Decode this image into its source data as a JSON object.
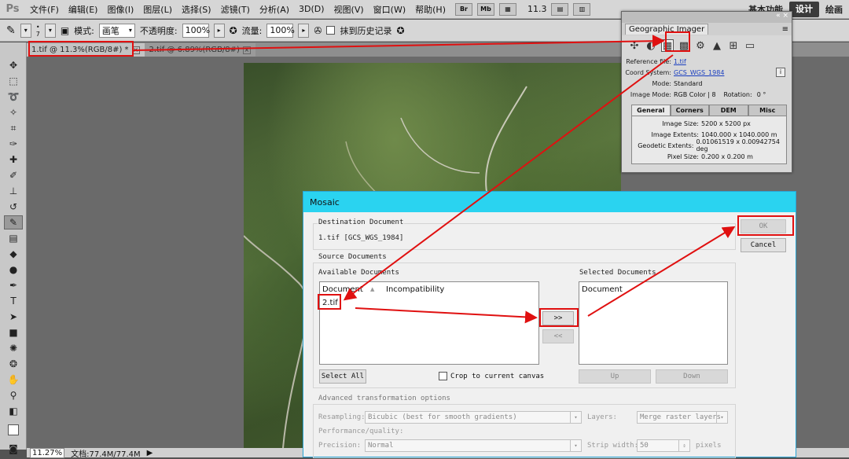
{
  "menubar": {
    "logo": "Ps",
    "items": [
      "文件(F)",
      "编辑(E)",
      "图像(I)",
      "图层(L)",
      "选择(S)",
      "滤镜(T)",
      "分析(A)",
      "3D(D)",
      "视图(V)",
      "窗口(W)",
      "帮助(H)"
    ],
    "mini_buttons": [
      "Br",
      "Mb"
    ],
    "zoom": "11.3",
    "workspaces": [
      "基本功能",
      "设计",
      "绘画"
    ]
  },
  "options": {
    "brush_size": "7",
    "mode_label": "模式:",
    "mode_value": "画笔",
    "opacity_label": "不透明度:",
    "opacity_value": "100%",
    "flow_label": "流量:",
    "flow_value": "100%",
    "erase_history_label": "抹到历史记录"
  },
  "tabs": [
    {
      "label": "1.tif @ 11.3%(RGB/8#) *",
      "active": true
    },
    {
      "label": "2.tif @ 6.89%(RGB/8#)",
      "active": false
    }
  ],
  "statusbar": {
    "zoom": "11.27%",
    "doc_info": "文档:77.4M/77.4M"
  },
  "geo_panel": {
    "tab": "Geographic Imager",
    "reference_file_label": "Reference file:",
    "reference_file": "1.tif",
    "coord_label": "Coord System:",
    "coord_value": "GCS_WGS_1984",
    "mode_label": "Mode:",
    "mode_value": "Standard",
    "image_mode_label": "Image Mode:",
    "image_mode_value": "RGB Color  |  8",
    "rotation_label": "Rotation:",
    "rotation_value": "0 °",
    "subtabs": [
      "General",
      "Corners",
      "DEM",
      "Misc"
    ],
    "image_size_label": "Image Size:",
    "image_size": "5200 x 5200 px",
    "image_extents_label": "Image Extents:",
    "image_extents": "1040.000 x 1040.000 m",
    "geodetic_label": "Geodetic Extents:",
    "geodetic": "0.01061519 x 0.00942754 deg",
    "pixel_size_label": "Pixel Size:",
    "pixel_size": "0.200 x 0.200 m"
  },
  "mosaic": {
    "title": "Mosaic",
    "destination_label": "Destination Document",
    "destination_value": "1.tif  [GCS_WGS_1984]",
    "source_label": "Source Documents",
    "available_label": "Available Documents",
    "available_col1": "Document",
    "available_col2": "Incompatibility",
    "available_items": [
      "2.tif"
    ],
    "selected_label": "Selected Documents",
    "selected_col1": "Document",
    "add_button": ">>",
    "remove_button": "<<",
    "select_all": "Select All",
    "crop_label": "Crop to current canvas",
    "up_button": "Up",
    "down_button": "Down",
    "ok_button": "OK",
    "cancel_button": "Cancel",
    "advanced_label": "Advanced transformation options",
    "resampling_label": "Resampling:",
    "resampling_value": "Bicubic (best for smooth gradients)",
    "layers_label": "Layers:",
    "layers_value": "Merge raster layers",
    "perf_label": "Performance/quality:",
    "precision_label": "Precision:",
    "precision_value": "Normal",
    "strip_label": "Strip width:",
    "strip_value": "50",
    "strip_unit": "pixels"
  }
}
